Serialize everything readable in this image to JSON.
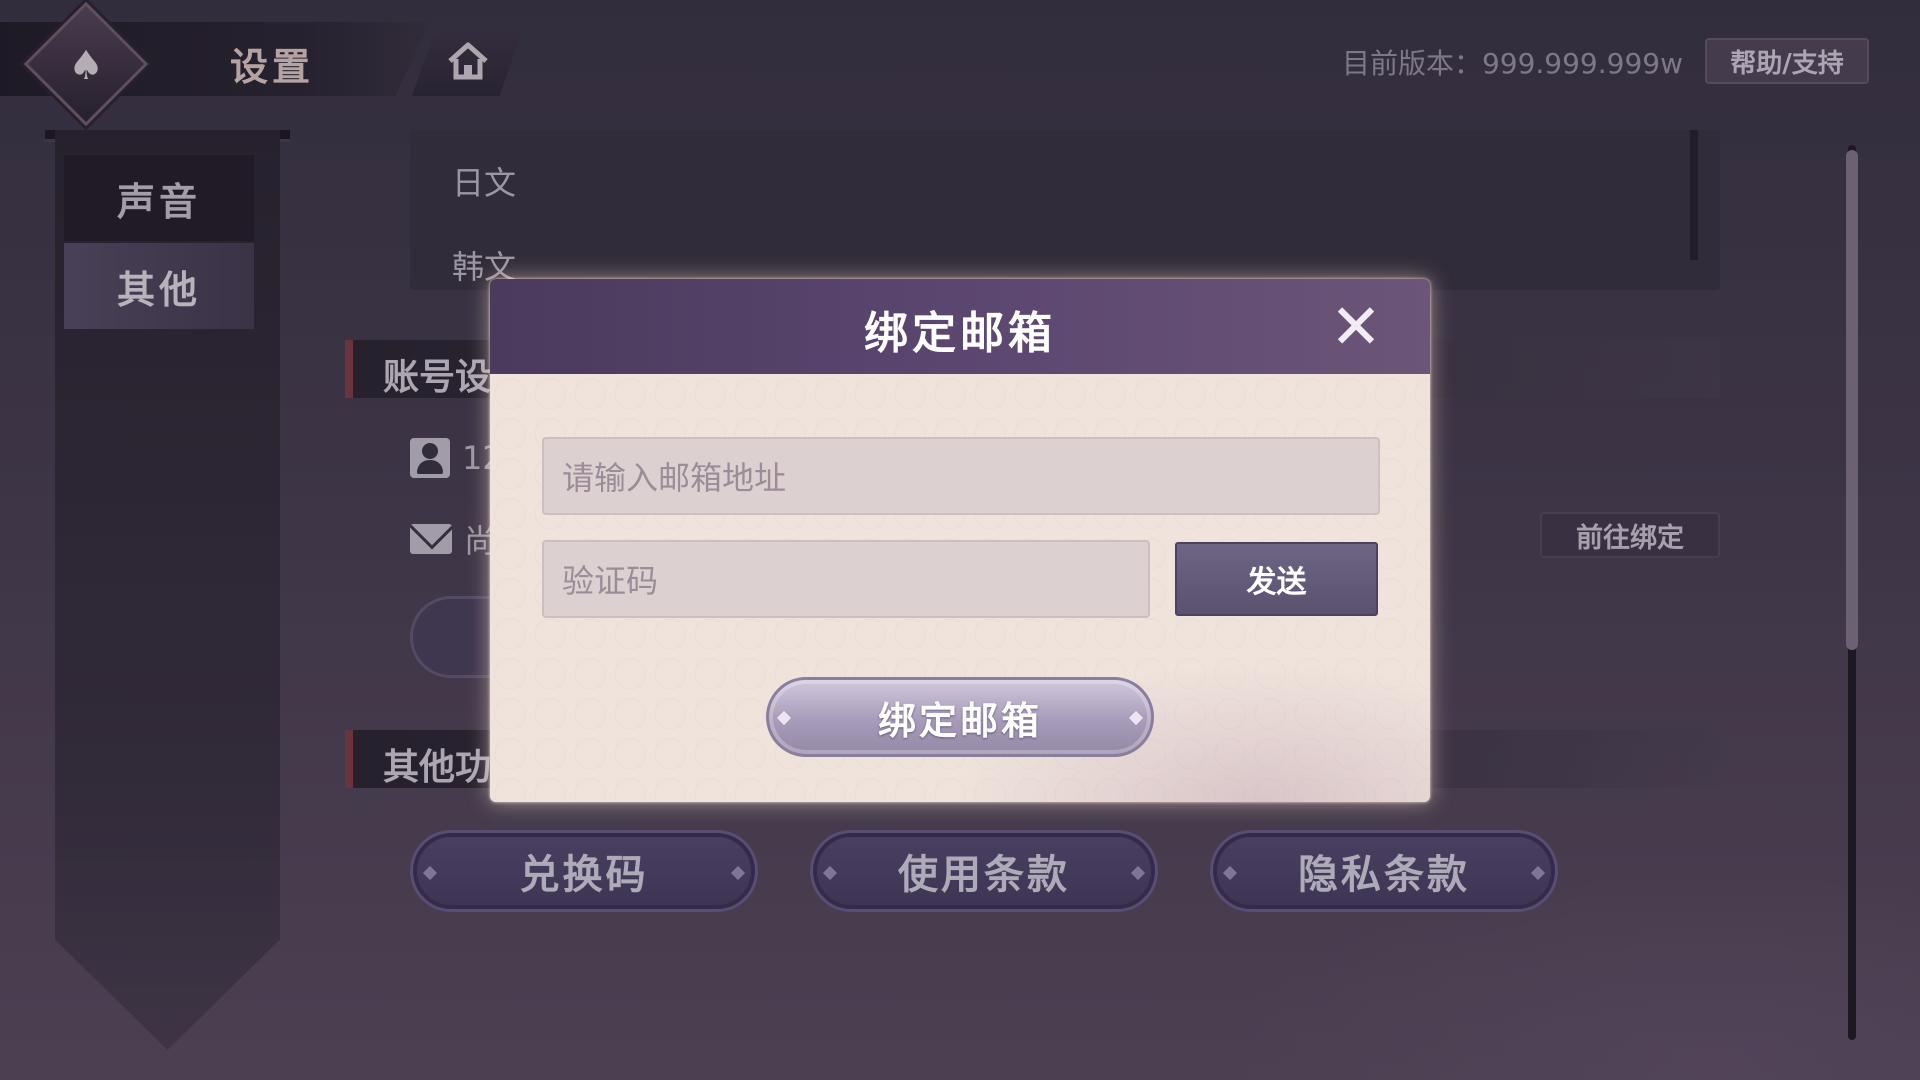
{
  "header": {
    "title": "设置",
    "home_icon": "home-icon",
    "logo_icon": "spade-logo-icon",
    "version_text": "目前版本：999.999.999w",
    "help_label": "帮助/支持"
  },
  "sidebar": {
    "items": [
      {
        "label": "声音",
        "selected": false
      },
      {
        "label": "其他",
        "selected": true
      }
    ]
  },
  "language_list": {
    "items": [
      "日文",
      "韩文"
    ]
  },
  "account_section": {
    "title": "账号设置",
    "user_id_partial": "12",
    "email_status_partial": "尚",
    "goto_bind_label": "前往绑定",
    "user_icon": "user-icon",
    "mail_icon": "mail-icon"
  },
  "other_section": {
    "title": "其他功能",
    "buttons": [
      "兑换码",
      "使用条款",
      "隐私条款"
    ]
  },
  "modal": {
    "title": "绑定邮箱",
    "close_icon": "close-icon",
    "email_placeholder": "请输入邮箱地址",
    "code_placeholder": "验证码",
    "send_label": "发送",
    "bind_label": "绑定邮箱"
  },
  "colors": {
    "background": "#4a4052",
    "modal_header": "#5b4670",
    "modal_body": "#efe3dc",
    "accent_red": "#8a3e45",
    "button_purple": "#5b4f78"
  }
}
